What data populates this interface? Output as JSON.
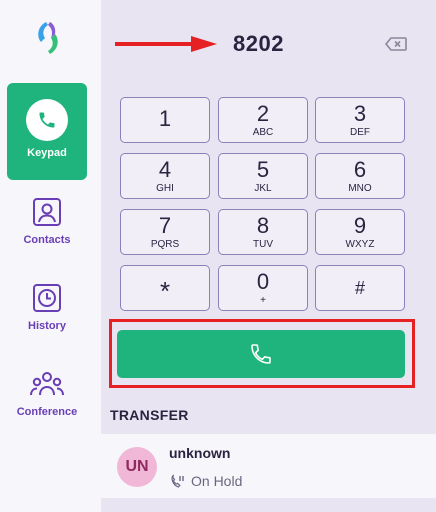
{
  "sidebar": {
    "items": [
      {
        "label": "Keypad",
        "icon": "phone-icon",
        "active": true
      },
      {
        "label": "Contacts",
        "icon": "contacts-icon",
        "active": false
      },
      {
        "label": "History",
        "icon": "clock-icon",
        "active": false
      },
      {
        "label": "Conference",
        "icon": "conference-icon",
        "active": false
      }
    ]
  },
  "dialer": {
    "number": "8202",
    "keys": [
      {
        "digit": "1",
        "letters": ""
      },
      {
        "digit": "2",
        "letters": "ABC"
      },
      {
        "digit": "3",
        "letters": "DEF"
      },
      {
        "digit": "4",
        "letters": "GHI"
      },
      {
        "digit": "5",
        "letters": "JKL"
      },
      {
        "digit": "6",
        "letters": "MNO"
      },
      {
        "digit": "7",
        "letters": "PQRS"
      },
      {
        "digit": "8",
        "letters": "TUV"
      },
      {
        "digit": "9",
        "letters": "WXYZ"
      },
      {
        "digit": "*",
        "letters": ""
      },
      {
        "digit": "0",
        "letters": "+"
      },
      {
        "digit": "#",
        "letters": ""
      }
    ]
  },
  "transfer": {
    "title": "TRANSFER",
    "contact": {
      "initials": "UN",
      "name": "unknown",
      "status": "On Hold"
    }
  },
  "colors": {
    "accent_green": "#1fb47e",
    "brand_purple": "#6a3fb5",
    "annotation_red": "#e62124"
  }
}
